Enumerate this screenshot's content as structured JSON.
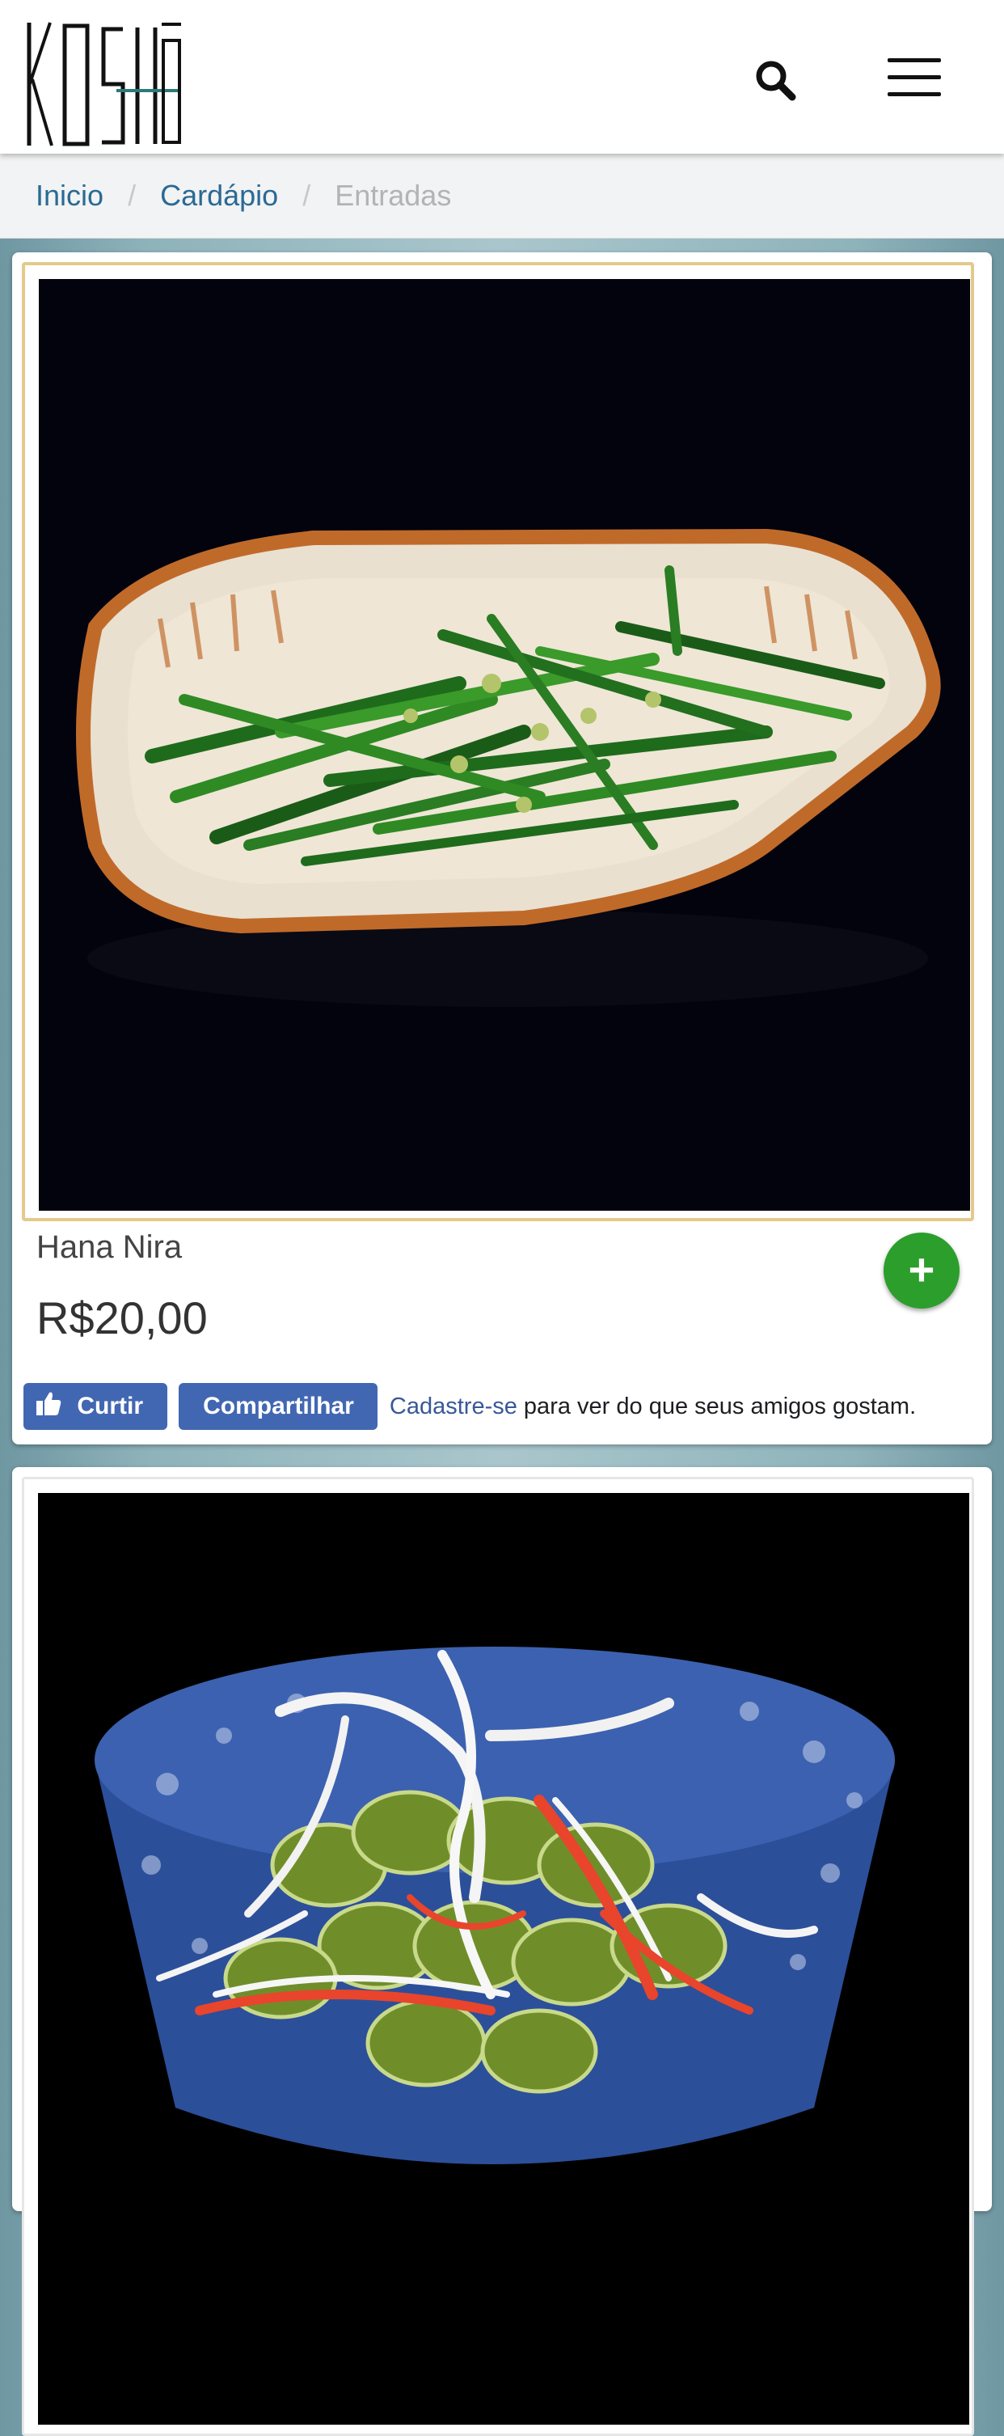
{
  "header": {
    "logo_text": "KOSHÔ",
    "search_icon": "search-icon",
    "menu_icon": "hamburger-menu-icon"
  },
  "breadcrumb": {
    "items": [
      {
        "label": "Inicio",
        "current": false
      },
      {
        "label": "Cardápio",
        "current": false
      },
      {
        "label": "Entradas",
        "current": true
      }
    ],
    "separator": "/"
  },
  "products": [
    {
      "name": "Hana Nira",
      "price": "R$20,00",
      "image": "garlic-chive-dish-photo",
      "add_icon": "plus-icon",
      "add_label": "+"
    },
    {
      "image": "cucumber-kani-salad-photo"
    }
  ],
  "social": {
    "like_label": "Curtir",
    "share_label": "Compartilhar",
    "signup_link": "Cadastre-se",
    "signup_text": " para ver do que seus amigos gostam."
  },
  "colors": {
    "link": "#2a6a94",
    "add_button": "#2c9e2c",
    "facebook": "#4267b2",
    "frame_gold": "#e3c98c"
  }
}
